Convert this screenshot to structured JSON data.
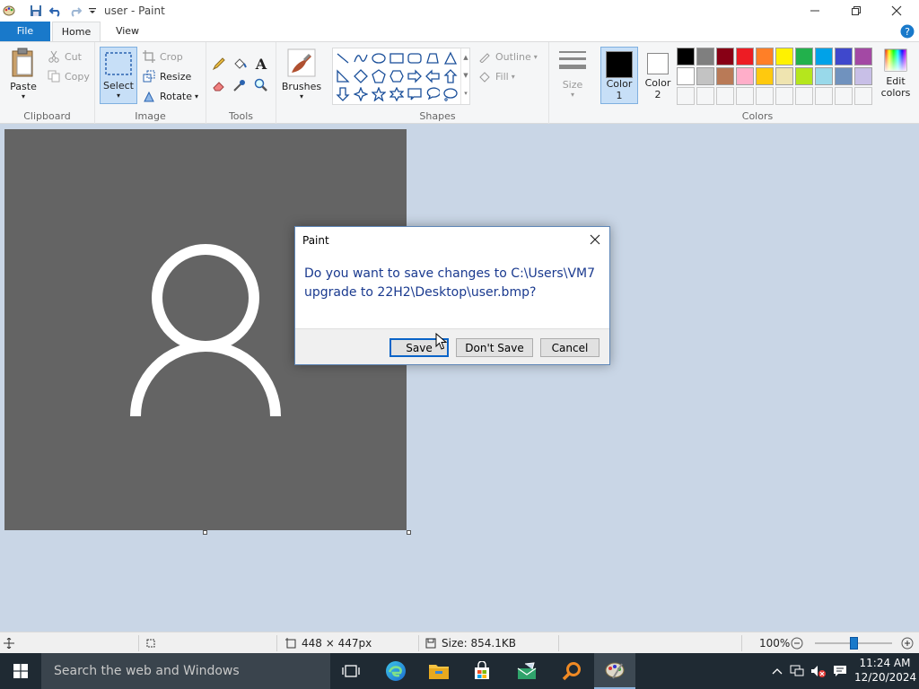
{
  "window": {
    "title": "user - Paint"
  },
  "tabs": {
    "file": "File",
    "home": "Home",
    "view": "View"
  },
  "ribbon": {
    "clipboard": {
      "label": "Clipboard",
      "paste": "Paste",
      "cut": "Cut",
      "copy": "Copy"
    },
    "image": {
      "label": "Image",
      "select": "Select",
      "crop": "Crop",
      "resize": "Resize",
      "rotate": "Rotate"
    },
    "tools": {
      "label": "Tools"
    },
    "brushes": {
      "label": "Brushes"
    },
    "shapes": {
      "label": "Shapes",
      "outline": "Outline",
      "fill": "Fill"
    },
    "size": {
      "label": "Size"
    },
    "colors": {
      "label": "Colors",
      "color1": "Color",
      "color1_num": "1",
      "color2": "Color",
      "color2_num": "2",
      "edit": "Edit",
      "edit2": "colors",
      "palette_row1": [
        "#000000",
        "#7f7f7f",
        "#880015",
        "#ed1c24",
        "#ff7f27",
        "#fff200",
        "#22b14c",
        "#00a2e8",
        "#3f48cc",
        "#a349a4"
      ],
      "palette_row2": [
        "#ffffff",
        "#c3c3c3",
        "#b97a57",
        "#ffaec9",
        "#ffc90e",
        "#efe4b0",
        "#b5e61d",
        "#99d9ea",
        "#7092be",
        "#c8bfe7"
      ]
    }
  },
  "dialog": {
    "title": "Paint",
    "message": "Do you want to save changes to C:\\Users\\VM7 upgrade to 22H2\\Desktop\\user.bmp?",
    "save": "Save",
    "dont_save": "Don't Save",
    "cancel": "Cancel"
  },
  "status": {
    "dimensions": "448 × 447px",
    "size": "Size: 854.1KB",
    "zoom": "100%",
    "zoom_level": 0.5
  },
  "taskbar": {
    "search_placeholder": "Search the web and Windows",
    "time": "11:24 AM",
    "date": "12/20/2024"
  }
}
